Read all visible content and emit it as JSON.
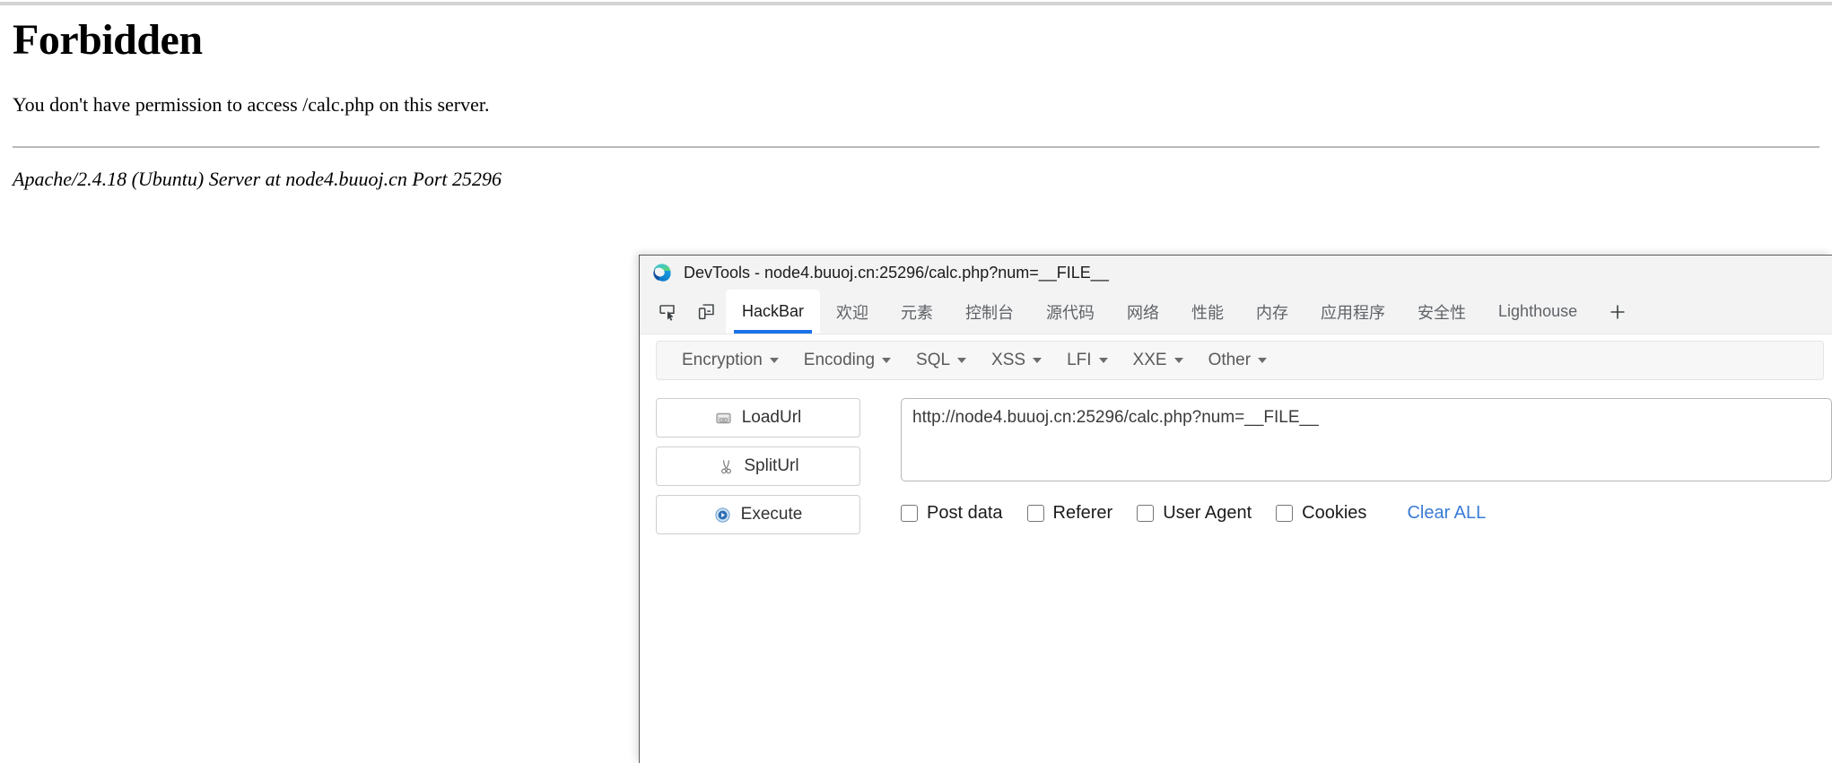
{
  "apache": {
    "heading": "Forbidden",
    "message": "You don't have permission to access /calc.php on this server.",
    "server_signature": "Apache/2.4.18 (Ubuntu) Server at node4.buuoj.cn Port 25296"
  },
  "devtools": {
    "title": "DevTools - node4.buuoj.cn:25296/calc.php?num=__FILE__",
    "logo_icon": "edge-logo-icon",
    "toolbar_icons": [
      {
        "name": "inspect-element-icon"
      },
      {
        "name": "device-toolbar-icon"
      }
    ],
    "tabs": [
      {
        "label": "HackBar",
        "active": true
      },
      {
        "label": "欢迎",
        "active": false
      },
      {
        "label": "元素",
        "active": false
      },
      {
        "label": "控制台",
        "active": false
      },
      {
        "label": "源代码",
        "active": false
      },
      {
        "label": "网络",
        "active": false
      },
      {
        "label": "性能",
        "active": false
      },
      {
        "label": "内存",
        "active": false
      },
      {
        "label": "应用程序",
        "active": false
      },
      {
        "label": "安全性",
        "active": false
      },
      {
        "label": "Lighthouse",
        "active": false
      }
    ],
    "add_tab_label": "+"
  },
  "hackbar": {
    "menus": [
      {
        "label": "Encryption"
      },
      {
        "label": "Encoding"
      },
      {
        "label": "SQL"
      },
      {
        "label": "XSS"
      },
      {
        "label": "LFI"
      },
      {
        "label": "XXE"
      },
      {
        "label": "Other"
      }
    ],
    "buttons": [
      {
        "label": "LoadUrl",
        "icon": "load-url-icon"
      },
      {
        "label": "SplitUrl",
        "icon": "split-url-scissors-icon"
      },
      {
        "label": "Execute",
        "icon": "execute-play-icon"
      }
    ],
    "url_value": "http://node4.buuoj.cn:25296/calc.php?num=__FILE__",
    "url_placeholder": "",
    "options": [
      {
        "label": "Post data",
        "checked": false
      },
      {
        "label": "Referer",
        "checked": false
      },
      {
        "label": "User Agent",
        "checked": false
      },
      {
        "label": "Cookies",
        "checked": false
      }
    ],
    "clear_all_label": "Clear ALL"
  },
  "colors": {
    "tab_accent": "#1a73e8",
    "link": "#3a7bd5",
    "titlebar_bg": "#f3f3f3"
  }
}
